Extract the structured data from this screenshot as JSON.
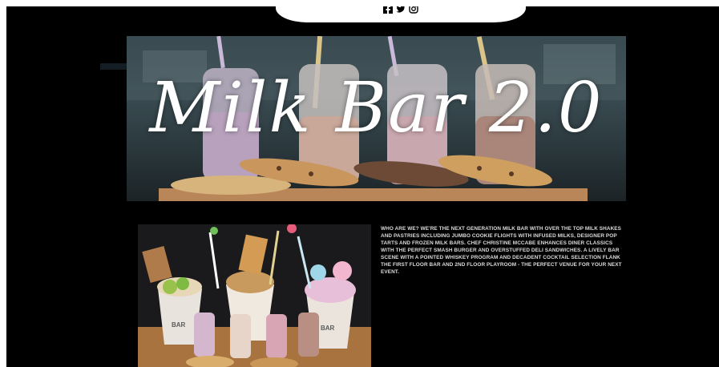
{
  "social": {
    "icons": [
      "facebook-icon",
      "twitter-icon",
      "instagram-icon"
    ]
  },
  "hero": {
    "title": "Milk Bar 2.0"
  },
  "about": {
    "text": "WHO ARE WE? WE'RE THE NEXT GENERATION MILK BAR WITH OVER THE TOP MILK SHAKES AND PASTRIES INCLUDING JUMBO COOKIE FLIGHTS WITH INFUSED MILKS, DESIGNER POP TARTS AND FROZEN MILK BARS. CHEF CHRISTINE MCCABE ENHANCES DINER CLASSICS WITH THE PERFECT SMASH BURGER AND OVERSTUFFED DELI SANDWICHES. A LIVELY BAR SCENE WITH A POINTED WHISKEY PROGRAM AND DECADENT COCKTAIL SELECTION FLANK THE FIRST FLOOR BAR AND 2ND FLOOR PLAYROOM - THE PERFECT VENUE FOR YOUR NEXT EVENT."
  },
  "photo": {
    "bottle_label": "BAR"
  },
  "colors": {
    "background": "#000000",
    "text": "#dcdcdc",
    "hero_title": "#ffffff"
  }
}
